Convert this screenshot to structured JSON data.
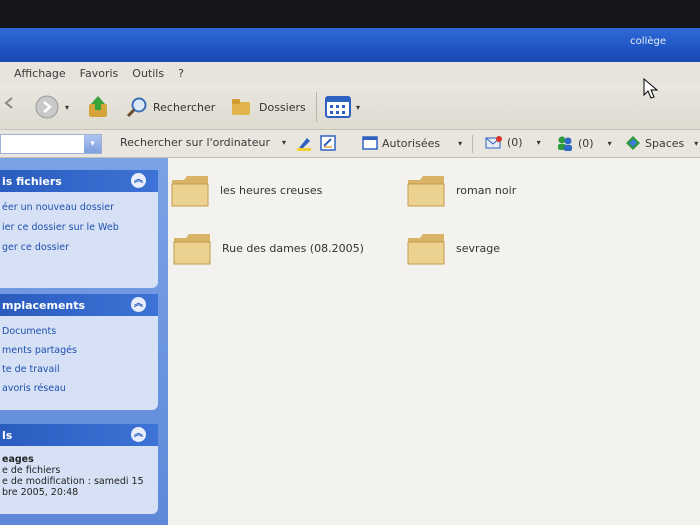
{
  "window": {
    "title": "collège"
  },
  "menu": {
    "items": [
      "Affichage",
      "Favoris",
      "Outils",
      "?"
    ]
  },
  "toolbar": {
    "search_label": "Rechercher",
    "folders_label": "Dossiers"
  },
  "address": {
    "search_computer": "Rechercher sur l'ordinateur",
    "authorized": "Autorisées",
    "count1": "(0)",
    "count2": "(0)",
    "spaces": "Spaces"
  },
  "sidebar": {
    "panel1": {
      "title": "is fichiers",
      "links": [
        "éer un nouveau dossier",
        "ier ce dossier sur le Web",
        "ger ce dossier"
      ]
    },
    "panel2": {
      "title": "mplacements",
      "links": [
        "Documents",
        "ments partagés",
        "te de travail",
        "avoris réseau"
      ]
    },
    "panel3": {
      "title": "ls",
      "lines": [
        "eages",
        "e de fichiers",
        "e de modification : samedi 15",
        "bre 2005, 20:48"
      ]
    }
  },
  "folders": [
    {
      "name": "les heures creuses"
    },
    {
      "name": "roman noir"
    },
    {
      "name": "Rue des dames (08.2005)"
    },
    {
      "name": "sevrage"
    }
  ]
}
